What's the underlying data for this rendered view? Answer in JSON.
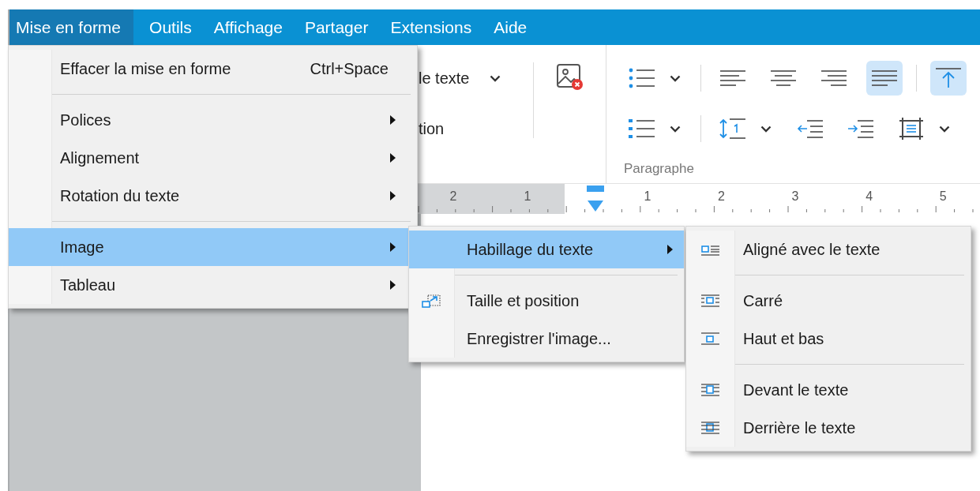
{
  "menubar": [
    {
      "label": "Mise en forme",
      "selected": true
    },
    {
      "label": "Outils",
      "selected": false
    },
    {
      "label": "Affichage",
      "selected": false
    },
    {
      "label": "Partager",
      "selected": false
    },
    {
      "label": "Extensions",
      "selected": false
    },
    {
      "label": "Aide",
      "selected": false
    }
  ],
  "ribbon": {
    "fragments": [
      {
        "text": "le texte",
        "dropdown": true
      },
      {
        "text": "tion",
        "dropdown": false
      }
    ],
    "paragraph": {
      "label": "Paragraphe",
      "rows": [
        {
          "buttons": [
            {
              "kind": "bullets",
              "dropdown": true,
              "selected": false,
              "divider_before": false
            },
            {
              "kind": "align_left",
              "dropdown": false,
              "selected": false,
              "divider_before": true
            },
            {
              "kind": "align_center",
              "dropdown": false,
              "selected": false,
              "divider_before": false
            },
            {
              "kind": "align_right",
              "dropdown": false,
              "selected": false,
              "divider_before": false
            },
            {
              "kind": "justify",
              "dropdown": false,
              "selected": true,
              "divider_before": false
            },
            {
              "kind": "valign_top",
              "dropdown": false,
              "selected": true,
              "divider_before": true
            }
          ]
        },
        {
          "buttons": [
            {
              "kind": "numbering",
              "dropdown": true,
              "selected": false,
              "divider_before": false
            },
            {
              "kind": "line_spacing",
              "dropdown": true,
              "selected": false,
              "divider_before": true
            },
            {
              "kind": "outdent",
              "dropdown": false,
              "selected": false,
              "divider_before": false
            },
            {
              "kind": "indent",
              "dropdown": false,
              "selected": false,
              "divider_before": false
            },
            {
              "kind": "cell_margins",
              "dropdown": true,
              "selected": false,
              "divider_before": false
            }
          ]
        }
      ]
    }
  },
  "ruler": {
    "left_numbers": [
      "2",
      "1"
    ],
    "right_numbers": [
      "1",
      "2",
      "3",
      "4",
      "5"
    ]
  },
  "format_menu": {
    "items": [
      {
        "label": "Effacer la mise en forme",
        "shortcut": "Ctrl+Space",
        "submenu": false,
        "selected": false,
        "separator_before": false
      },
      {
        "label": "Polices",
        "submenu": true,
        "selected": false,
        "separator_before": true
      },
      {
        "label": "Alignement",
        "submenu": true,
        "selected": false,
        "separator_before": false
      },
      {
        "label": "Rotation du texte",
        "submenu": true,
        "selected": false,
        "separator_before": false
      },
      {
        "label": "Image",
        "submenu": true,
        "selected": true,
        "separator_before": true
      },
      {
        "label": "Tableau",
        "submenu": true,
        "selected": false,
        "separator_before": false
      }
    ]
  },
  "image_submenu": {
    "items": [
      {
        "label": "Habillage du texte",
        "submenu": true,
        "selected": true,
        "separator_before": false
      },
      {
        "label": "Taille et position",
        "kind": "resize",
        "submenu": false,
        "selected": false,
        "separator_before": true
      },
      {
        "label": "Enregistrer l'image...",
        "submenu": false,
        "selected": false,
        "separator_before": false
      }
    ]
  },
  "wrap_submenu": {
    "items": [
      {
        "label": "Aligné avec le texte",
        "kind": "inline",
        "submenu": false,
        "selected": false,
        "separator_before": false
      },
      {
        "label": "Carré",
        "kind": "square",
        "submenu": false,
        "selected": false,
        "separator_before": true
      },
      {
        "label": "Haut et bas",
        "kind": "top_bottom",
        "submenu": false,
        "selected": false,
        "separator_before": false
      },
      {
        "label": "Devant le texte",
        "kind": "in_front",
        "submenu": false,
        "selected": false,
        "separator_before": true
      },
      {
        "label": "Derrière le texte",
        "kind": "behind",
        "submenu": false,
        "selected": false,
        "separator_before": false
      }
    ]
  }
}
